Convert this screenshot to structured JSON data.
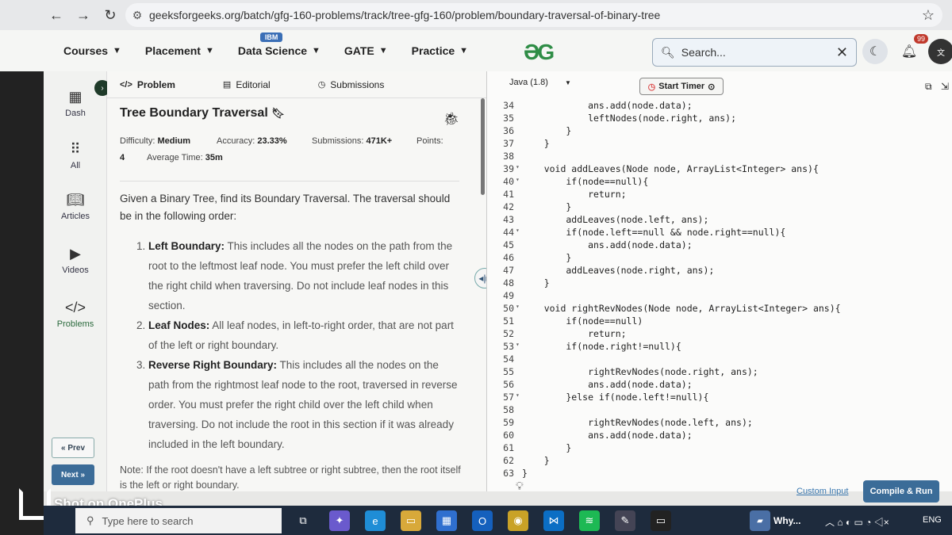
{
  "browser": {
    "url": "geeksforgeeks.org/batch/gfg-160-problems/track/tree-gfg-160/problem/boundary-traversal-of-binary-tree"
  },
  "header": {
    "menu": [
      "Courses",
      "Placement",
      "Data Science",
      "GATE",
      "Practice"
    ],
    "ibm_badge": "IBM",
    "logo": "ƏG",
    "search_placeholder": "Search...",
    "notif_count": "99"
  },
  "rail": {
    "items": [
      "Dash",
      "All",
      "Articles",
      "Videos",
      "Problems"
    ],
    "prev": "« Prev",
    "next": "Next »"
  },
  "problem": {
    "tabs": [
      "Problem",
      "Editorial",
      "Submissions"
    ],
    "title": "Tree Boundary Traversal",
    "difficulty_label": "Difficulty:",
    "difficulty": "Medium",
    "accuracy_label": "Accuracy:",
    "accuracy": "23.33%",
    "submissions_label": "Submissions:",
    "submissions": "471K+",
    "points_label": "Points:",
    "points": "4",
    "avg_time_label": "Average Time:",
    "avg_time": "35m",
    "intro": "Given a Binary Tree, find its Boundary Traversal. The traversal should be in the following order:",
    "rules": [
      {
        "head": "Left Boundary:",
        "body": " This includes all the nodes on the path from the root to the leftmost leaf node. You must prefer the left child over the right child when traversing. Do not include leaf nodes in this section."
      },
      {
        "head": "Leaf Nodes:",
        "body": " All leaf nodes, in left-to-right order, that are not part of the left or right boundary."
      },
      {
        "head": "Reverse Right Boundary:",
        "body": " This includes all the nodes on the path from the rightmost leaf node to the root, traversed in reverse order. You must prefer the right child over the left child when traversing. Do not include the root in this section if it was already included in the left boundary."
      }
    ],
    "note": "Note: If the root doesn't have a left subtree or right subtree, then the root itself is the left or right boundary."
  },
  "editor": {
    "language": "Java (1.8)",
    "timer": "Start Timer",
    "custom_input": "Custom Input",
    "compile": "Compile & Run",
    "lines": [
      {
        "n": "34",
        "f": "",
        "t": "            ans.add(node.data);"
      },
      {
        "n": "35",
        "f": "",
        "t": "            leftNodes(node.right, ans);"
      },
      {
        "n": "36",
        "f": "",
        "t": "        }"
      },
      {
        "n": "37",
        "f": "",
        "t": "    }"
      },
      {
        "n": "38",
        "f": "",
        "t": ""
      },
      {
        "n": "39",
        "f": "▾",
        "t": "    void addLeaves(Node node, ArrayList<Integer> ans){"
      },
      {
        "n": "40",
        "f": "▾",
        "t": "        if(node==null){"
      },
      {
        "n": "41",
        "f": "",
        "t": "            return;"
      },
      {
        "n": "42",
        "f": "",
        "t": "        }"
      },
      {
        "n": "43",
        "f": "",
        "t": "        addLeaves(node.left, ans);"
      },
      {
        "n": "44",
        "f": "▾",
        "t": "        if(node.left==null && node.right==null){"
      },
      {
        "n": "45",
        "f": "",
        "t": "            ans.add(node.data);"
      },
      {
        "n": "46",
        "f": "",
        "t": "        }"
      },
      {
        "n": "47",
        "f": "",
        "t": "        addLeaves(node.right, ans);"
      },
      {
        "n": "48",
        "f": "",
        "t": "    }"
      },
      {
        "n": "49",
        "f": "",
        "t": ""
      },
      {
        "n": "50",
        "f": "▾",
        "t": "    void rightRevNodes(Node node, ArrayList<Integer> ans){"
      },
      {
        "n": "51",
        "f": "",
        "t": "        if(node==null)"
      },
      {
        "n": "52",
        "f": "",
        "t": "            return;"
      },
      {
        "n": "53",
        "f": "▾",
        "t": "        if(node.right!=null){"
      },
      {
        "n": "54",
        "f": "",
        "t": ""
      },
      {
        "n": "55",
        "f": "",
        "t": "            rightRevNodes(node.right, ans);"
      },
      {
        "n": "56",
        "f": "",
        "t": "            ans.add(node.data);"
      },
      {
        "n": "57",
        "f": "▾",
        "t": "        }else if(node.left!=null){"
      },
      {
        "n": "58",
        "f": "",
        "t": ""
      },
      {
        "n": "59",
        "f": "",
        "t": "            rightRevNodes(node.left, ans);"
      },
      {
        "n": "60",
        "f": "",
        "t": "            ans.add(node.data);"
      },
      {
        "n": "61",
        "f": "",
        "t": "        }"
      },
      {
        "n": "62",
        "f": "",
        "t": "    }"
      },
      {
        "n": "63",
        "f": "",
        "t": "}"
      }
    ]
  },
  "taskbar": {
    "search_placeholder": "Type here to search",
    "tray_app": "Why...",
    "lang": "ENG"
  },
  "watermark": "Shot on OnePlus"
}
